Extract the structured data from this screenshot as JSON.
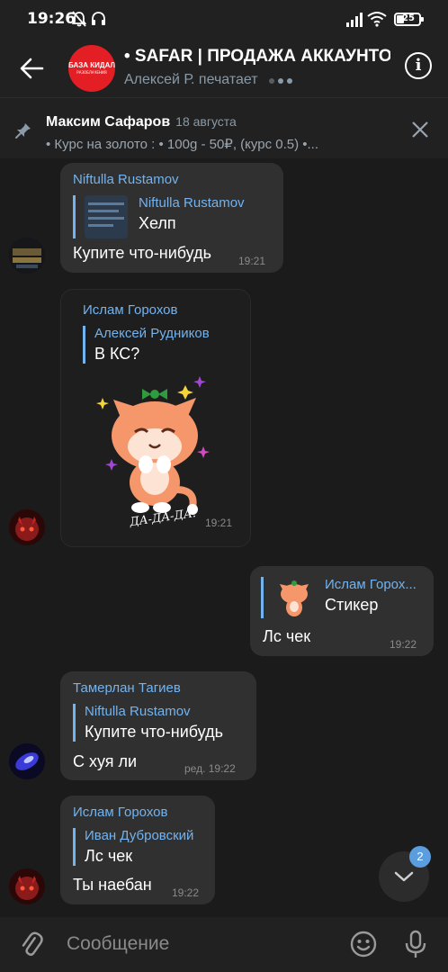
{
  "status_bar": {
    "time": "19:26",
    "battery": "25"
  },
  "header": {
    "title": "• SAFAR | ПРОДАЖА АККАУНТОВ",
    "status": "Алексей Р. печатает",
    "avatar_text": "БАЗА КИДАЛ",
    "avatar_subtext": "РАЗОБЛАЧЕНИЯ"
  },
  "pinned": {
    "name": "Максим Сафаров",
    "date": "18 августа",
    "text": "• Курс на золото : • 100g - 50₽, (курс 0.5) •..."
  },
  "messages": [
    {
      "sender": "Niftulla Rustamov",
      "reply_name": "Niftulla Rustamov",
      "reply_text": "Хелп",
      "text": "Купите что-нибудь",
      "time": "19:21"
    },
    {
      "sender": "Ислам Горохов",
      "reply_name": "Алексей Рудников",
      "reply_text": "В КС?",
      "sticker_caption": "ДА-ДА-ДА!",
      "time": "19:21"
    },
    {
      "reply_name": "Ислам Горох...",
      "reply_text": "Стикер",
      "text": "Лс чек",
      "time": "19:22"
    },
    {
      "sender": "Тамерлан Тагиев",
      "reply_name": "Niftulla Rustamov",
      "reply_text": "Купите что-нибудь",
      "text": "С хуя ли",
      "time": "ред. 19:22"
    },
    {
      "sender": "Ислам Горохов",
      "reply_name": "Иван Дубровский",
      "reply_text": "Лс чек",
      "text": "Ты наебан",
      "time": "19:22"
    }
  ],
  "scroll_badge": "2",
  "input": {
    "placeholder": "Сообщение"
  },
  "colors": {
    "background": "#1b1b1b",
    "bubble": "#303030",
    "accent": "#72b3f0",
    "avatar_red": "#e31e24"
  }
}
